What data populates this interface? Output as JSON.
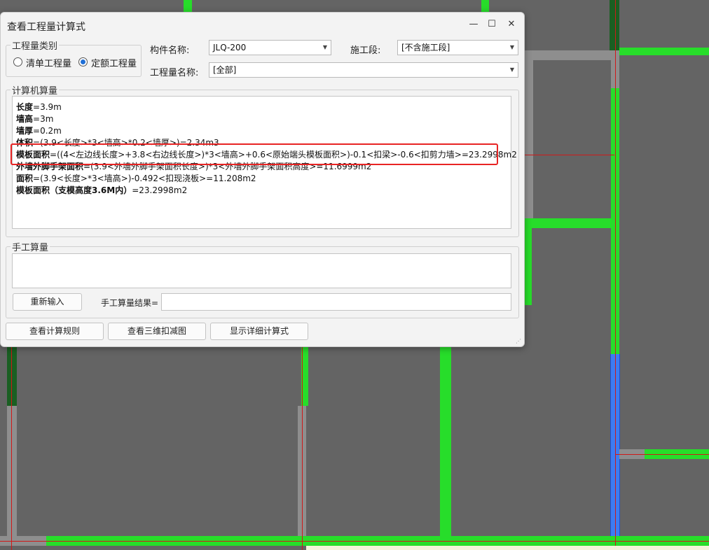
{
  "dialog": {
    "title": "查看工程量计算式",
    "controls": {
      "minimize": "—",
      "maximize": "☐",
      "close": "✕"
    }
  },
  "category": {
    "label": "工程量类别",
    "options": [
      {
        "label": "清单工程量",
        "checked": false
      },
      {
        "label": "定额工程量",
        "checked": true
      }
    ]
  },
  "filters": {
    "component_label": "构件名称:",
    "component_value": "JLQ-200",
    "segment_label": "施工段:",
    "segment_value": "[不含施工段]",
    "quantity_label": "工程量名称:",
    "quantity_value": "[全部]"
  },
  "computer": {
    "label": "计算机算量",
    "lines": [
      {
        "name": "长度",
        "expr": "=3.9m"
      },
      {
        "name": "墙高",
        "expr": "=3m"
      },
      {
        "name": "墙厚",
        "expr": "=0.2m"
      },
      {
        "name": "体积",
        "expr": "=(3.9<长度>*3<墙高>*0.2<墙厚>)=2.34m3"
      },
      {
        "name": "模板面积",
        "expr": "=((4<左边线长度>+3.8<右边线长度>)*3<墙高>+0.6<原始端头模板面积>)-0.1<扣梁>-0.6<扣剪力墙>=23.2998m2"
      },
      {
        "name": "外墙外脚手架面积",
        "expr": "=(3.9<外墙外脚手架面积长度>)*3<外墙外脚手架面积高度>=11.6999m2"
      },
      {
        "name": "面积",
        "expr": "=(3.9<长度>*3<墙高>)-0.492<扣现浇板>=11.208m2"
      },
      {
        "name": "模板面积（支模高度3.6M内）",
        "expr": "=23.2998m2"
      }
    ]
  },
  "manual": {
    "label": "手工算量",
    "reinput_button": "重新输入",
    "result_label": "手工算量结果="
  },
  "buttons": {
    "rules": "查看计算规则",
    "view3d": "查看三维扣减图",
    "detail": "显示详细计算式"
  },
  "colors": {
    "wall_green": "#27dd2a",
    "highlight_red": "#e82424",
    "selected_blue": "#3d7cf2"
  }
}
